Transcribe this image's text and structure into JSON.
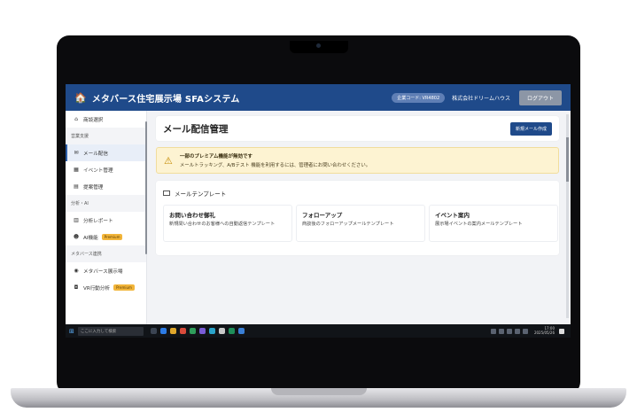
{
  "header": {
    "logo_icon": "house-icon",
    "title": "メタバース住宅展示場 SFAシステム",
    "company_code": "企業コード: VR4802",
    "company_name": "株式会社ドリームハウス",
    "logout_label": "ログアウト",
    "brand_color": "#1f4a8a"
  },
  "sidebar": {
    "items": [
      {
        "type": "item",
        "icon": "house-icon",
        "label": "商談選択"
      },
      {
        "type": "section",
        "label": "営業支援"
      },
      {
        "type": "item",
        "icon": "mail-icon",
        "label": "メール配信",
        "active": true
      },
      {
        "type": "item",
        "icon": "calendar-icon",
        "label": "イベント管理"
      },
      {
        "type": "item",
        "icon": "document-icon",
        "label": "提案管理"
      },
      {
        "type": "section",
        "label": "分析・AI"
      },
      {
        "type": "item",
        "icon": "report-icon",
        "label": "分析レポート"
      },
      {
        "type": "item",
        "icon": "robot-icon",
        "label": "AI機能",
        "badge": "Premium"
      },
      {
        "type": "section",
        "label": "メタバース連携"
      },
      {
        "type": "item",
        "icon": "globe-icon",
        "label": "メタバース展示場"
      },
      {
        "type": "item",
        "icon": "vr-icon",
        "label": "VR行動分析",
        "badge": "Premium"
      }
    ]
  },
  "main": {
    "page_title": "メール配信管理",
    "new_mail_label": "新規メール作成",
    "alert": {
      "title": "一部のプレミアム機能が無効です",
      "text": "メールトラッキング、A/Bテスト 機能を利用するには、管理者にお問い合わせください。"
    },
    "templates": {
      "heading": "メールテンプレート",
      "cards": [
        {
          "title": "お問い合わせ御礼",
          "desc": "新規問い合わせのお客様への自動返信テンプレート"
        },
        {
          "title": "フォローアップ",
          "desc": "商談後のフォローアップメールテンプレート"
        },
        {
          "title": "イベント案内",
          "desc": "展示場イベントの案内メールテンプレート"
        }
      ]
    }
  },
  "taskbar": {
    "search_placeholder": "ここに入力して検索",
    "time": "17:00",
    "date": "2025/05/26"
  }
}
